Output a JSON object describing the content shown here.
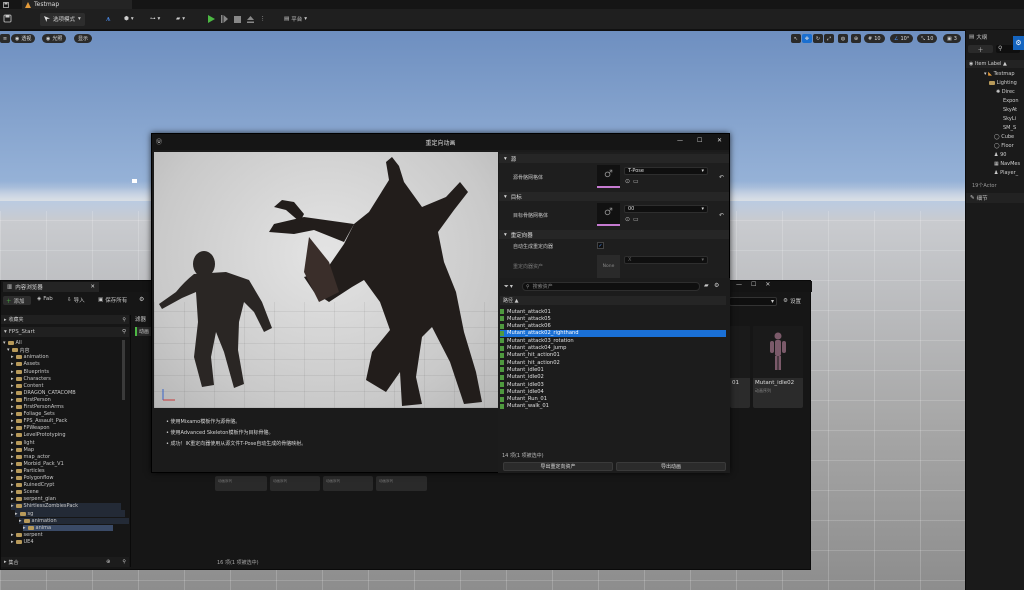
{
  "app": {
    "tab_title": "Testmap"
  },
  "toolbar": {
    "mode_label": "选项模式",
    "platform_label": "平台"
  },
  "viewport": {
    "pills": [
      "透视",
      "光照",
      "显示"
    ],
    "right_values": [
      "10",
      "10°",
      "10",
      "3"
    ]
  },
  "outliner": {
    "title": "大纲",
    "column_label": "Item Label ▲",
    "items": [
      "Testmap",
      "Lighting",
      "Direc",
      "Expon",
      "SkyAt",
      "SkyLi",
      "SM_S",
      "Cube",
      "Floor",
      "90",
      "NavMes",
      "Player_"
    ],
    "actor_count": "19个Actor",
    "details_tab": "细节"
  },
  "content_browser": {
    "title": "内容浏览器",
    "add_label": "添加",
    "fab_label": "Fab",
    "import_label": "导入",
    "save_all_label": "保存所有",
    "favorites_label": "收藏夹",
    "project_label": "FPS_Start",
    "filter_label": "滤器",
    "anim_chip": "动画",
    "settings_label": "设置",
    "tree": [
      {
        "label": "All",
        "depth": 0
      },
      {
        "label": "内容",
        "depth": 1
      },
      {
        "label": "animation",
        "depth": 2
      },
      {
        "label": "Assets",
        "depth": 2
      },
      {
        "label": "Blueprints",
        "depth": 2
      },
      {
        "label": "Characters",
        "depth": 2
      },
      {
        "label": "Content",
        "depth": 2
      },
      {
        "label": "DRAGON_CATACOMB",
        "depth": 2
      },
      {
        "label": "FirstPerson",
        "depth": 2
      },
      {
        "label": "FirstPersonArms",
        "depth": 2
      },
      {
        "label": "Foliage_Sets",
        "depth": 2
      },
      {
        "label": "FPS_Assault_Pack",
        "depth": 2
      },
      {
        "label": "FPWeapon",
        "depth": 2
      },
      {
        "label": "LevelPrototyping",
        "depth": 2
      },
      {
        "label": "light",
        "depth": 2
      },
      {
        "label": "Map",
        "depth": 2
      },
      {
        "label": "map_actor",
        "depth": 2
      },
      {
        "label": "Morbid_Pack_V1",
        "depth": 2
      },
      {
        "label": "Particles",
        "depth": 2
      },
      {
        "label": "Polygonflow",
        "depth": 2
      },
      {
        "label": "RuinedCrypt",
        "depth": 2
      },
      {
        "label": "Scene",
        "depth": 2
      },
      {
        "label": "serpent_gian",
        "depth": 2
      },
      {
        "label": "ShirtlessZombiesPack",
        "depth": 2
      },
      {
        "label": "sg",
        "depth": 3
      },
      {
        "label": "animation",
        "depth": 4
      },
      {
        "label": "anima",
        "depth": 5
      },
      {
        "label": "serpent",
        "depth": 2
      },
      {
        "label": "UE4",
        "depth": 2
      }
    ],
    "collections_label": "集合",
    "status": "16 项(1 项被选中)",
    "tiles": [
      {
        "name": "01",
        "type": ""
      },
      {
        "name": "Mutant_idle02",
        "type": "动画序列"
      }
    ],
    "bottom_tiles": [
      "动画序列",
      "动画序列",
      "动画序列",
      "动画序列"
    ]
  },
  "dialog": {
    "title": "重定向动画",
    "source_section": "源",
    "source_label": "源骨骼网格体",
    "source_value": "T-Pose",
    "target_section": "目标",
    "target_label": "目标骨骼网格体",
    "target_value": "00",
    "retarget_section": "重定向器",
    "auto_label": "自动生成重定向器",
    "asset_label": "重定向器资产",
    "asset_value": "X",
    "asset_thumb": "None",
    "notes": [
      "使用Mixamo模板作为源骨骼。",
      "使用Advanced Skeleton模板作为目标骨骼。",
      "成功！IK重定向器使用从源文件T-Pose自动生成的骨骼映射。"
    ]
  },
  "asset_list": {
    "search_placeholder": "搜索资产",
    "column_header": "路径 ▲",
    "items": [
      "Mutant_attack01",
      "Mutant_attack05",
      "Mutant_attack06",
      "Mutant_attack02_righthand",
      "Mutant_attack03_rotation",
      "Mutant_attack04_jump",
      "Mutant_hit_action01",
      "Mutant_hit_action02",
      "Mutant_idle01",
      "Mutant_idle02",
      "Mutant_idle03",
      "Mutant_idle04",
      "Mutant_Run_01",
      "Mutant_walk_01"
    ],
    "selected_index": 3,
    "status": "14 项(1 项被选中)",
    "export_retargeter_label": "导出重定向资产",
    "export_anim_label": "导出动画"
  }
}
